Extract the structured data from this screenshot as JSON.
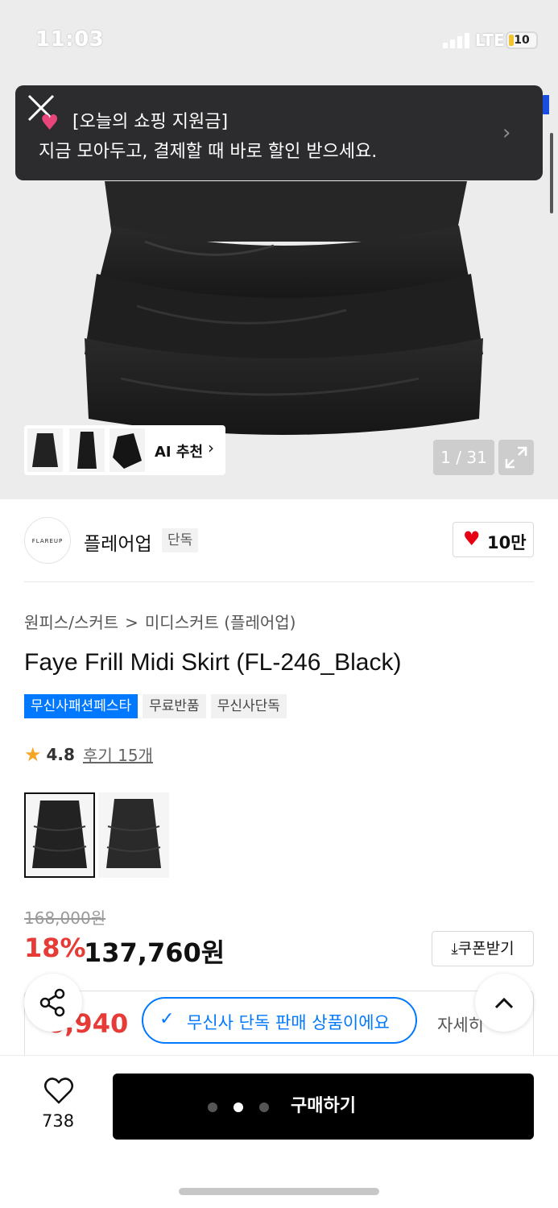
{
  "status_bar": {
    "time": "11:03",
    "network": "LTE",
    "battery": "10"
  },
  "toast": {
    "line1": "[오늘의 쇼핑 지원금]",
    "line2": "지금 모아두고, 결제할 때 바로 할인 받으세요."
  },
  "hero": {
    "ai_recommend_label": "AI 추천",
    "page_counter": "1 / 31"
  },
  "brand": {
    "logo_text": "FLAREUP",
    "name": "플레어업",
    "tag": "단독",
    "like_count": "10만"
  },
  "product": {
    "breadcrumb": [
      "원피스/스커트",
      "미디스커트 (플레어업)"
    ],
    "breadcrumb_separator": ">",
    "title": "Faye Frill Midi Skirt (FL-246_Black)",
    "badges": [
      "무신사패션페스타",
      "무료반품",
      "무신사단독"
    ],
    "rating": "4.8",
    "review_label": "후기 15개"
  },
  "price": {
    "original": "168,000원",
    "discount": "18%",
    "sale": "137,760원",
    "coupon_label": "쿠폰받기",
    "benefit_price_partial": "6,940",
    "benefit_detail": "자세히"
  },
  "exclusive_toast": "무신사 단독 판매 상품이에요",
  "bottom_bar": {
    "wish_count": "738",
    "buy_label": "구매하기"
  },
  "colors": {
    "accent_blue": "#0078ff",
    "discount_red": "#e63b36",
    "heart_red": "#e60012"
  }
}
